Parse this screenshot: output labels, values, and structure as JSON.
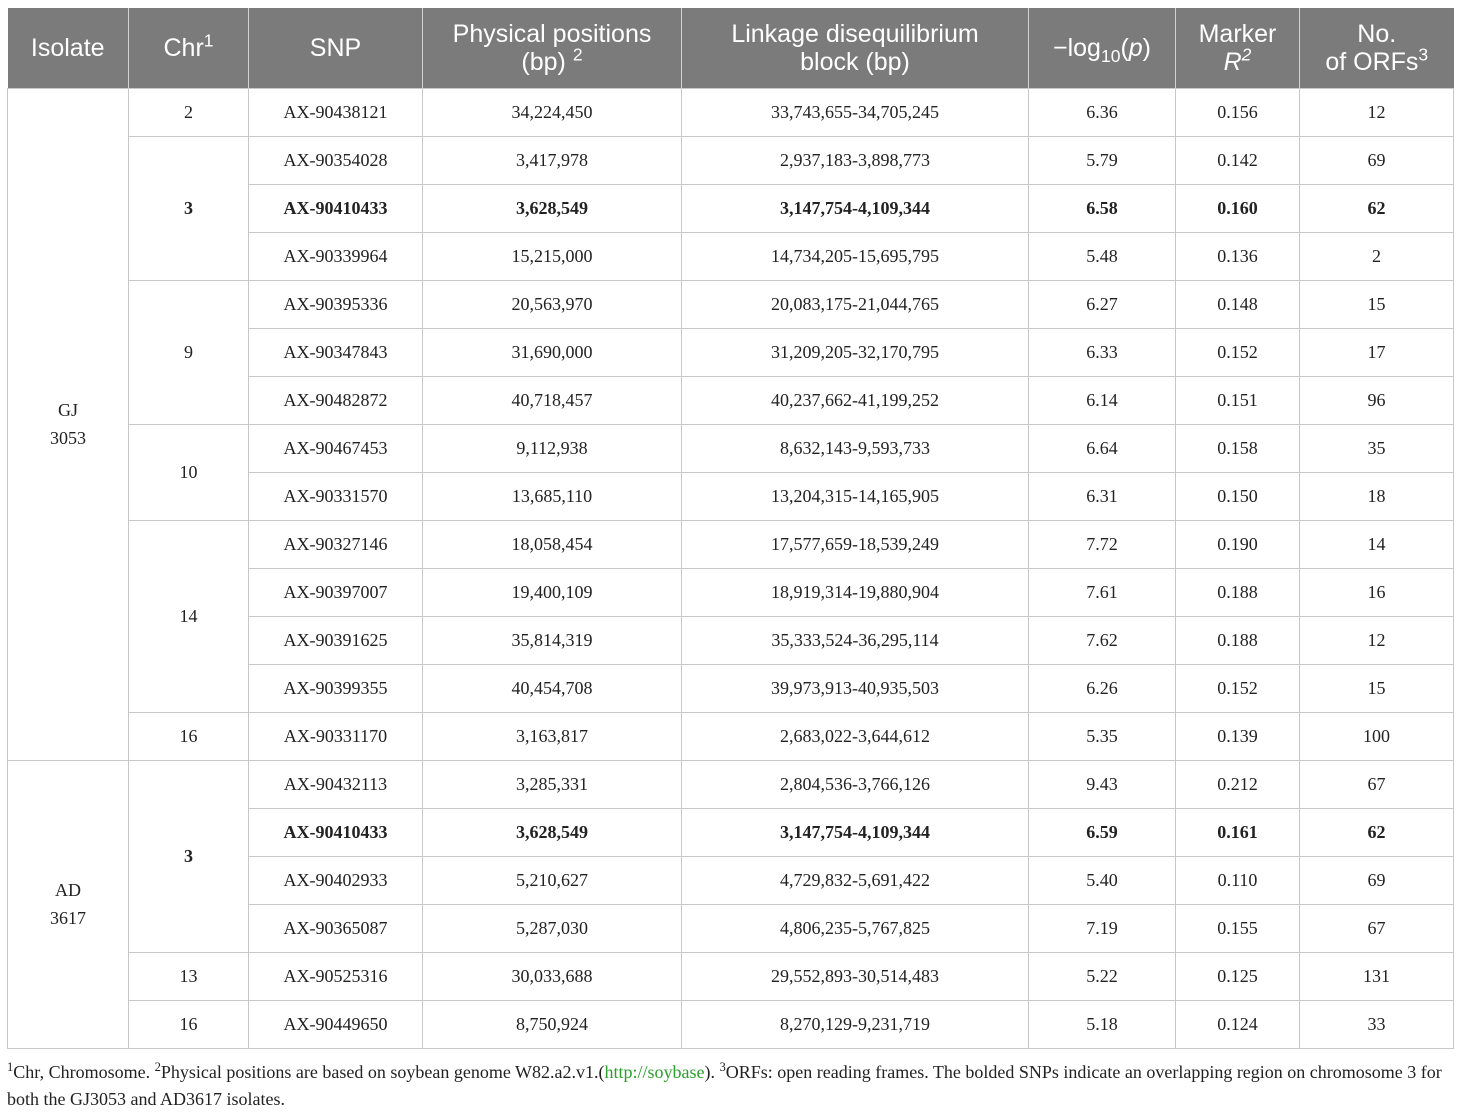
{
  "table": {
    "headers": {
      "isolate": "Isolate",
      "chr": "Chr",
      "chr_sup": "1",
      "snp": "SNP",
      "pos_line1": "Physical positions",
      "pos_line2": "(bp)",
      "pos_sup": "2",
      "ld_line1": "Linkage disequilibrium",
      "ld_line2": "block (bp)",
      "logp_prefix": "−log",
      "logp_sub": "10",
      "logp_open": "(",
      "logp_p": "p",
      "logp_close": ")",
      "marker_line1": "Marker",
      "marker_r": "R",
      "marker_sup": "2",
      "orf_line1": "No.",
      "orf_line2": "of ORFs",
      "orf_sup": "3"
    },
    "groups": [
      {
        "isolate_line1": "GJ",
        "isolate_line2": "3053",
        "chromosomes": [
          {
            "chr": "2",
            "bold": false,
            "rows": [
              {
                "snp": "AX-90438121",
                "pos": "34,224,450",
                "ld": "33,743,655-34,705,245",
                "logp": "6.36",
                "r2": "0.156",
                "orfs": "12",
                "bold": false
              }
            ]
          },
          {
            "chr": "3",
            "bold": true,
            "rows": [
              {
                "snp": "AX-90354028",
                "pos": "3,417,978",
                "ld": "2,937,183-3,898,773",
                "logp": "5.79",
                "r2": "0.142",
                "orfs": "69",
                "bold": false
              },
              {
                "snp": "AX-90410433",
                "pos": "3,628,549",
                "ld": "3,147,754-4,109,344",
                "logp": "6.58",
                "r2": "0.160",
                "orfs": "62",
                "bold": true
              },
              {
                "snp": "AX-90339964",
                "pos": "15,215,000",
                "ld": "14,734,205-15,695,795",
                "logp": "5.48",
                "r2": "0.136",
                "orfs": "2",
                "bold": false
              }
            ]
          },
          {
            "chr": "9",
            "bold": false,
            "rows": [
              {
                "snp": "AX-90395336",
                "pos": "20,563,970",
                "ld": "20,083,175-21,044,765",
                "logp": "6.27",
                "r2": "0.148",
                "orfs": "15",
                "bold": false
              },
              {
                "snp": "AX-90347843",
                "pos": "31,690,000",
                "ld": "31,209,205-32,170,795",
                "logp": "6.33",
                "r2": "0.152",
                "orfs": "17",
                "bold": false
              },
              {
                "snp": "AX-90482872",
                "pos": "40,718,457",
                "ld": "40,237,662-41,199,252",
                "logp": "6.14",
                "r2": "0.151",
                "orfs": "96",
                "bold": false
              }
            ]
          },
          {
            "chr": "10",
            "bold": false,
            "rows": [
              {
                "snp": "AX-90467453",
                "pos": "9,112,938",
                "ld": "8,632,143-9,593,733",
                "logp": "6.64",
                "r2": "0.158",
                "orfs": "35",
                "bold": false
              },
              {
                "snp": "AX-90331570",
                "pos": "13,685,110",
                "ld": "13,204,315-14,165,905",
                "logp": "6.31",
                "r2": "0.150",
                "orfs": "18",
                "bold": false
              }
            ]
          },
          {
            "chr": "14",
            "bold": false,
            "rows": [
              {
                "snp": "AX-90327146",
                "pos": "18,058,454",
                "ld": "17,577,659-18,539,249",
                "logp": "7.72",
                "r2": "0.190",
                "orfs": "14",
                "bold": false
              },
              {
                "snp": "AX-90397007",
                "pos": "19,400,109",
                "ld": "18,919,314-19,880,904",
                "logp": "7.61",
                "r2": "0.188",
                "orfs": "16",
                "bold": false
              },
              {
                "snp": "AX-90391625",
                "pos": "35,814,319",
                "ld": "35,333,524-36,295,114",
                "logp": "7.62",
                "r2": "0.188",
                "orfs": "12",
                "bold": false
              },
              {
                "snp": "AX-90399355",
                "pos": "40,454,708",
                "ld": "39,973,913-40,935,503",
                "logp": "6.26",
                "r2": "0.152",
                "orfs": "15",
                "bold": false
              }
            ]
          },
          {
            "chr": "16",
            "bold": false,
            "rows": [
              {
                "snp": "AX-90331170",
                "pos": "3,163,817",
                "ld": "2,683,022-3,644,612",
                "logp": "5.35",
                "r2": "0.139",
                "orfs": "100",
                "bold": false
              }
            ]
          }
        ]
      },
      {
        "isolate_line1": "AD",
        "isolate_line2": "3617",
        "chromosomes": [
          {
            "chr": "3",
            "bold": true,
            "rows": [
              {
                "snp": "AX-90432113",
                "pos": "3,285,331",
                "ld": "2,804,536-3,766,126",
                "logp": "9.43",
                "r2": "0.212",
                "orfs": "67",
                "bold": false
              },
              {
                "snp": "AX-90410433",
                "pos": "3,628,549",
                "ld": "3,147,754-4,109,344",
                "logp": "6.59",
                "r2": "0.161",
                "orfs": "62",
                "bold": true
              },
              {
                "snp": "AX-90402933",
                "pos": "5,210,627",
                "ld": "4,729,832-5,691,422",
                "logp": "5.40",
                "r2": "0.110",
                "orfs": "69",
                "bold": false
              },
              {
                "snp": "AX-90365087",
                "pos": "5,287,030",
                "ld": "4,806,235-5,767,825",
                "logp": "7.19",
                "r2": "0.155",
                "orfs": "67",
                "bold": false
              }
            ]
          },
          {
            "chr": "13",
            "bold": false,
            "rows": [
              {
                "snp": "AX-90525316",
                "pos": "30,033,688",
                "ld": "29,552,893-30,514,483",
                "logp": "5.22",
                "r2": "0.125",
                "orfs": "131",
                "bold": false
              }
            ]
          },
          {
            "chr": "16",
            "bold": false,
            "rows": [
              {
                "snp": "AX-90449650",
                "pos": "8,750,924",
                "ld": "8,270,129-9,231,719",
                "logp": "5.18",
                "r2": "0.124",
                "orfs": "33",
                "bold": false
              }
            ]
          }
        ]
      }
    ]
  },
  "footnote": {
    "sup1": "1",
    "text1": "Chr, Chromosome. ",
    "sup2": "2",
    "text2": "Physical positions are based on soybean genome W82.a2.v1.(",
    "link": "http://soybase",
    "text3": "). ",
    "sup3": "3",
    "text4": "ORFs: open reading frames. The bolded SNPs indicate an overlapping region on chromosome 3 for both the GJ3053 and AD3617 isolates."
  },
  "colors": {
    "header_bg": "#7b7b7b",
    "header_text": "#ffffff",
    "border": "#c8c8c8",
    "link": "#2aa02a"
  }
}
